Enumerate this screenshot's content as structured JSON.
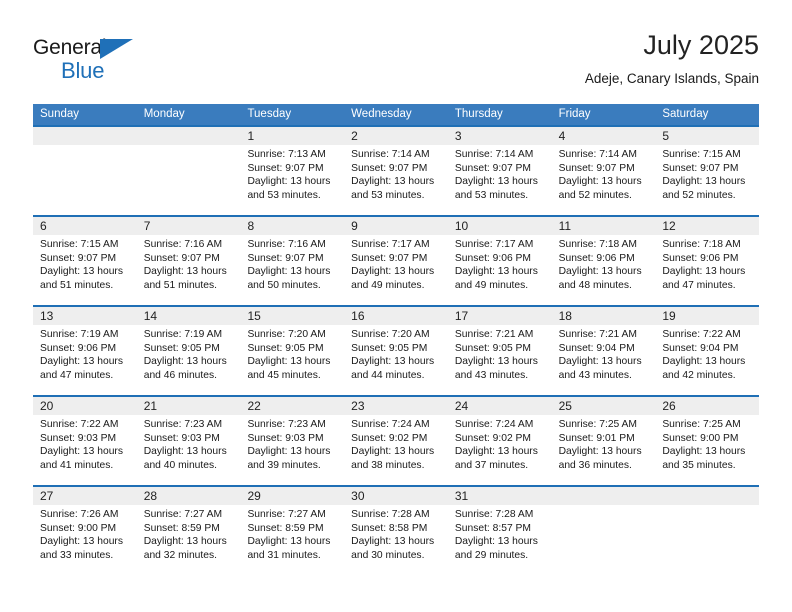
{
  "branding": {
    "logo_primary": "General",
    "logo_secondary": "Blue",
    "triangle_color": "#1f70b8"
  },
  "header": {
    "title": "July 2025",
    "subtitle": "Adeje, Canary Islands, Spain"
  },
  "theme": {
    "header_blue": "#3a7cbe",
    "row_border_blue": "#1f6fb5",
    "day_band_gray": "#eeeeee"
  },
  "weekdays": [
    "Sunday",
    "Monday",
    "Tuesday",
    "Wednesday",
    "Thursday",
    "Friday",
    "Saturday"
  ],
  "weeks": [
    [
      {
        "day": "",
        "sunrise": "",
        "sunset": "",
        "daylight_line1": "",
        "daylight_line2": ""
      },
      {
        "day": "",
        "sunrise": "",
        "sunset": "",
        "daylight_line1": "",
        "daylight_line2": ""
      },
      {
        "day": "1",
        "sunrise": "Sunrise: 7:13 AM",
        "sunset": "Sunset: 9:07 PM",
        "daylight_line1": "Daylight: 13 hours",
        "daylight_line2": "and 53 minutes."
      },
      {
        "day": "2",
        "sunrise": "Sunrise: 7:14 AM",
        "sunset": "Sunset: 9:07 PM",
        "daylight_line1": "Daylight: 13 hours",
        "daylight_line2": "and 53 minutes."
      },
      {
        "day": "3",
        "sunrise": "Sunrise: 7:14 AM",
        "sunset": "Sunset: 9:07 PM",
        "daylight_line1": "Daylight: 13 hours",
        "daylight_line2": "and 53 minutes."
      },
      {
        "day": "4",
        "sunrise": "Sunrise: 7:14 AM",
        "sunset": "Sunset: 9:07 PM",
        "daylight_line1": "Daylight: 13 hours",
        "daylight_line2": "and 52 minutes."
      },
      {
        "day": "5",
        "sunrise": "Sunrise: 7:15 AM",
        "sunset": "Sunset: 9:07 PM",
        "daylight_line1": "Daylight: 13 hours",
        "daylight_line2": "and 52 minutes."
      }
    ],
    [
      {
        "day": "6",
        "sunrise": "Sunrise: 7:15 AM",
        "sunset": "Sunset: 9:07 PM",
        "daylight_line1": "Daylight: 13 hours",
        "daylight_line2": "and 51 minutes."
      },
      {
        "day": "7",
        "sunrise": "Sunrise: 7:16 AM",
        "sunset": "Sunset: 9:07 PM",
        "daylight_line1": "Daylight: 13 hours",
        "daylight_line2": "and 51 minutes."
      },
      {
        "day": "8",
        "sunrise": "Sunrise: 7:16 AM",
        "sunset": "Sunset: 9:07 PM",
        "daylight_line1": "Daylight: 13 hours",
        "daylight_line2": "and 50 minutes."
      },
      {
        "day": "9",
        "sunrise": "Sunrise: 7:17 AM",
        "sunset": "Sunset: 9:07 PM",
        "daylight_line1": "Daylight: 13 hours",
        "daylight_line2": "and 49 minutes."
      },
      {
        "day": "10",
        "sunrise": "Sunrise: 7:17 AM",
        "sunset": "Sunset: 9:06 PM",
        "daylight_line1": "Daylight: 13 hours",
        "daylight_line2": "and 49 minutes."
      },
      {
        "day": "11",
        "sunrise": "Sunrise: 7:18 AM",
        "sunset": "Sunset: 9:06 PM",
        "daylight_line1": "Daylight: 13 hours",
        "daylight_line2": "and 48 minutes."
      },
      {
        "day": "12",
        "sunrise": "Sunrise: 7:18 AM",
        "sunset": "Sunset: 9:06 PM",
        "daylight_line1": "Daylight: 13 hours",
        "daylight_line2": "and 47 minutes."
      }
    ],
    [
      {
        "day": "13",
        "sunrise": "Sunrise: 7:19 AM",
        "sunset": "Sunset: 9:06 PM",
        "daylight_line1": "Daylight: 13 hours",
        "daylight_line2": "and 47 minutes."
      },
      {
        "day": "14",
        "sunrise": "Sunrise: 7:19 AM",
        "sunset": "Sunset: 9:05 PM",
        "daylight_line1": "Daylight: 13 hours",
        "daylight_line2": "and 46 minutes."
      },
      {
        "day": "15",
        "sunrise": "Sunrise: 7:20 AM",
        "sunset": "Sunset: 9:05 PM",
        "daylight_line1": "Daylight: 13 hours",
        "daylight_line2": "and 45 minutes."
      },
      {
        "day": "16",
        "sunrise": "Sunrise: 7:20 AM",
        "sunset": "Sunset: 9:05 PM",
        "daylight_line1": "Daylight: 13 hours",
        "daylight_line2": "and 44 minutes."
      },
      {
        "day": "17",
        "sunrise": "Sunrise: 7:21 AM",
        "sunset": "Sunset: 9:05 PM",
        "daylight_line1": "Daylight: 13 hours",
        "daylight_line2": "and 43 minutes."
      },
      {
        "day": "18",
        "sunrise": "Sunrise: 7:21 AM",
        "sunset": "Sunset: 9:04 PM",
        "daylight_line1": "Daylight: 13 hours",
        "daylight_line2": "and 43 minutes."
      },
      {
        "day": "19",
        "sunrise": "Sunrise: 7:22 AM",
        "sunset": "Sunset: 9:04 PM",
        "daylight_line1": "Daylight: 13 hours",
        "daylight_line2": "and 42 minutes."
      }
    ],
    [
      {
        "day": "20",
        "sunrise": "Sunrise: 7:22 AM",
        "sunset": "Sunset: 9:03 PM",
        "daylight_line1": "Daylight: 13 hours",
        "daylight_line2": "and 41 minutes."
      },
      {
        "day": "21",
        "sunrise": "Sunrise: 7:23 AM",
        "sunset": "Sunset: 9:03 PM",
        "daylight_line1": "Daylight: 13 hours",
        "daylight_line2": "and 40 minutes."
      },
      {
        "day": "22",
        "sunrise": "Sunrise: 7:23 AM",
        "sunset": "Sunset: 9:03 PM",
        "daylight_line1": "Daylight: 13 hours",
        "daylight_line2": "and 39 minutes."
      },
      {
        "day": "23",
        "sunrise": "Sunrise: 7:24 AM",
        "sunset": "Sunset: 9:02 PM",
        "daylight_line1": "Daylight: 13 hours",
        "daylight_line2": "and 38 minutes."
      },
      {
        "day": "24",
        "sunrise": "Sunrise: 7:24 AM",
        "sunset": "Sunset: 9:02 PM",
        "daylight_line1": "Daylight: 13 hours",
        "daylight_line2": "and 37 minutes."
      },
      {
        "day": "25",
        "sunrise": "Sunrise: 7:25 AM",
        "sunset": "Sunset: 9:01 PM",
        "daylight_line1": "Daylight: 13 hours",
        "daylight_line2": "and 36 minutes."
      },
      {
        "day": "26",
        "sunrise": "Sunrise: 7:25 AM",
        "sunset": "Sunset: 9:00 PM",
        "daylight_line1": "Daylight: 13 hours",
        "daylight_line2": "and 35 minutes."
      }
    ],
    [
      {
        "day": "27",
        "sunrise": "Sunrise: 7:26 AM",
        "sunset": "Sunset: 9:00 PM",
        "daylight_line1": "Daylight: 13 hours",
        "daylight_line2": "and 33 minutes."
      },
      {
        "day": "28",
        "sunrise": "Sunrise: 7:27 AM",
        "sunset": "Sunset: 8:59 PM",
        "daylight_line1": "Daylight: 13 hours",
        "daylight_line2": "and 32 minutes."
      },
      {
        "day": "29",
        "sunrise": "Sunrise: 7:27 AM",
        "sunset": "Sunset: 8:59 PM",
        "daylight_line1": "Daylight: 13 hours",
        "daylight_line2": "and 31 minutes."
      },
      {
        "day": "30",
        "sunrise": "Sunrise: 7:28 AM",
        "sunset": "Sunset: 8:58 PM",
        "daylight_line1": "Daylight: 13 hours",
        "daylight_line2": "and 30 minutes."
      },
      {
        "day": "31",
        "sunrise": "Sunrise: 7:28 AM",
        "sunset": "Sunset: 8:57 PM",
        "daylight_line1": "Daylight: 13 hours",
        "daylight_line2": "and 29 minutes."
      },
      {
        "day": "",
        "sunrise": "",
        "sunset": "",
        "daylight_line1": "",
        "daylight_line2": ""
      },
      {
        "day": "",
        "sunrise": "",
        "sunset": "",
        "daylight_line1": "",
        "daylight_line2": ""
      }
    ]
  ]
}
